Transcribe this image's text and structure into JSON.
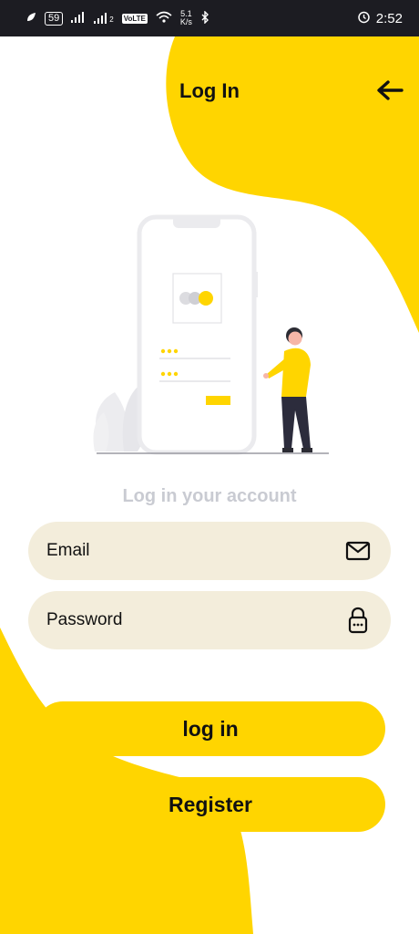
{
  "status_bar": {
    "battery": "59",
    "speed_value": "5.1",
    "speed_unit": "K/s",
    "volte": "VoLTE",
    "sim2": "2",
    "time": "2:52",
    "icons": [
      "leaf-icon",
      "signal-icon",
      "signal-icon",
      "volte-icon",
      "wifi-icon",
      "bluetooth-icon",
      "alarm-icon"
    ]
  },
  "header": {
    "title": "Log In",
    "back_icon": "arrow-left-icon"
  },
  "main": {
    "subtitle": "Log in your account",
    "email": {
      "placeholder": "Email",
      "value": "",
      "icon": "mail-icon"
    },
    "password": {
      "placeholder": "Password",
      "value": "",
      "icon": "lock-icon"
    },
    "login_label": "log in",
    "register_label": "Register"
  },
  "colors": {
    "accent": "#ffd500",
    "field_bg": "#f3eddb",
    "subtitle": "#c9cbd2",
    "statusbar_bg": "#1c1c22"
  }
}
